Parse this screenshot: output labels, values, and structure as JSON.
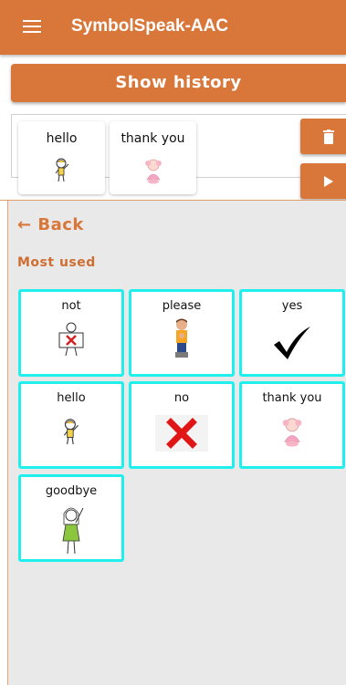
{
  "app": {
    "title": "SymbolSpeak-AAC"
  },
  "history_button": {
    "label": "Show history"
  },
  "sentence": {
    "items": [
      {
        "label": "hello",
        "icon": "waving-child-icon"
      },
      {
        "label": "thank you",
        "icon": "thank-you-girl-icon"
      }
    ]
  },
  "actions": {
    "delete_icon": "trash-icon",
    "play_icon": "play-icon"
  },
  "nav": {
    "back_label": "← Back"
  },
  "section": {
    "title": "Most used"
  },
  "tiles": [
    {
      "label": "not",
      "icon": "not-sign-icon"
    },
    {
      "label": "please",
      "icon": "please-boy-icon"
    },
    {
      "label": "yes",
      "icon": "checkmark-icon"
    },
    {
      "label": "hello",
      "icon": "waving-child-icon"
    },
    {
      "label": "no",
      "icon": "red-x-icon"
    },
    {
      "label": "thank you",
      "icon": "thank-you-girl-icon"
    },
    {
      "label": "goodbye",
      "icon": "goodbye-girl-icon"
    }
  ],
  "colors": {
    "primary": "#d9773a",
    "tile_border": "#1ff0ee",
    "background": "#e9e9e9"
  }
}
